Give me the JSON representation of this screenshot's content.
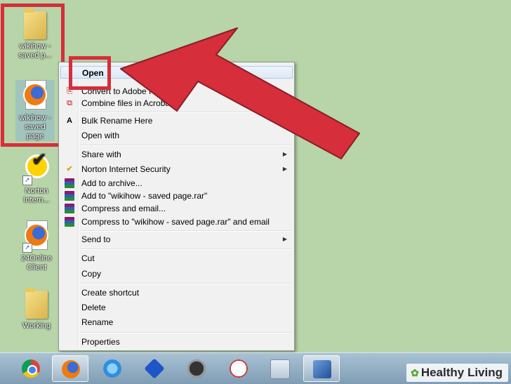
{
  "desktop_icons": [
    {
      "label": "wikihow - saved p...",
      "type": "folder"
    },
    {
      "label": "wikihow - saved page",
      "type": "firefox-document"
    },
    {
      "label": "Norton Intern...",
      "type": "norton"
    },
    {
      "label": "24Online Client",
      "type": "firefox-shortcut"
    },
    {
      "label": "Working",
      "type": "folder"
    }
  ],
  "context_menu": {
    "open": "Open",
    "convert_pdf": "Convert to Adobe PDF",
    "combine_acrobat": "Combine files in Acrobat...",
    "bulk_rename": "Bulk Rename Here",
    "open_with": "Open with",
    "share_with": "Share with",
    "norton": "Norton Internet Security",
    "add_archive": "Add to archive...",
    "add_rar": "Add to \"wikihow - saved page.rar\"",
    "compress_email": "Compress and email...",
    "compress_rar_email": "Compress to \"wikihow - saved page.rar\" and email",
    "send_to": "Send to",
    "cut": "Cut",
    "copy": "Copy",
    "create_shortcut": "Create shortcut",
    "delete": "Delete",
    "rename": "Rename",
    "properties": "Properties"
  },
  "taskbar": [
    "chrome-icon",
    "firefox-icon",
    "sync-icon",
    "puzzle-icon",
    "speedometer-icon",
    "cat-icon",
    "monitor-icon",
    "virtualbox-icon"
  ],
  "watermark": {
    "brand": "Healthy Living"
  },
  "colors": {
    "annotation_red": "#d62e3a",
    "desktop_bg": "#b7d5a8"
  }
}
